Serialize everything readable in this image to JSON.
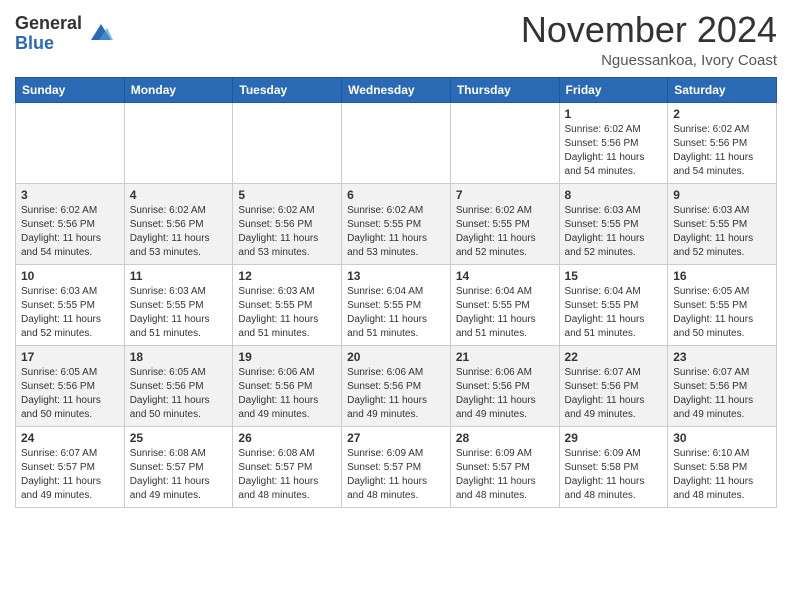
{
  "header": {
    "logo_general": "General",
    "logo_blue": "Blue",
    "month_title": "November 2024",
    "location": "Nguessankoa, Ivory Coast"
  },
  "days_of_week": [
    "Sunday",
    "Monday",
    "Tuesday",
    "Wednesday",
    "Thursday",
    "Friday",
    "Saturday"
  ],
  "weeks": [
    [
      {
        "day": "",
        "info": ""
      },
      {
        "day": "",
        "info": ""
      },
      {
        "day": "",
        "info": ""
      },
      {
        "day": "",
        "info": ""
      },
      {
        "day": "",
        "info": ""
      },
      {
        "day": "1",
        "info": "Sunrise: 6:02 AM\nSunset: 5:56 PM\nDaylight: 11 hours and 54 minutes."
      },
      {
        "day": "2",
        "info": "Sunrise: 6:02 AM\nSunset: 5:56 PM\nDaylight: 11 hours and 54 minutes."
      }
    ],
    [
      {
        "day": "3",
        "info": "Sunrise: 6:02 AM\nSunset: 5:56 PM\nDaylight: 11 hours and 54 minutes."
      },
      {
        "day": "4",
        "info": "Sunrise: 6:02 AM\nSunset: 5:56 PM\nDaylight: 11 hours and 53 minutes."
      },
      {
        "day": "5",
        "info": "Sunrise: 6:02 AM\nSunset: 5:56 PM\nDaylight: 11 hours and 53 minutes."
      },
      {
        "day": "6",
        "info": "Sunrise: 6:02 AM\nSunset: 5:55 PM\nDaylight: 11 hours and 53 minutes."
      },
      {
        "day": "7",
        "info": "Sunrise: 6:02 AM\nSunset: 5:55 PM\nDaylight: 11 hours and 52 minutes."
      },
      {
        "day": "8",
        "info": "Sunrise: 6:03 AM\nSunset: 5:55 PM\nDaylight: 11 hours and 52 minutes."
      },
      {
        "day": "9",
        "info": "Sunrise: 6:03 AM\nSunset: 5:55 PM\nDaylight: 11 hours and 52 minutes."
      }
    ],
    [
      {
        "day": "10",
        "info": "Sunrise: 6:03 AM\nSunset: 5:55 PM\nDaylight: 11 hours and 52 minutes."
      },
      {
        "day": "11",
        "info": "Sunrise: 6:03 AM\nSunset: 5:55 PM\nDaylight: 11 hours and 51 minutes."
      },
      {
        "day": "12",
        "info": "Sunrise: 6:03 AM\nSunset: 5:55 PM\nDaylight: 11 hours and 51 minutes."
      },
      {
        "day": "13",
        "info": "Sunrise: 6:04 AM\nSunset: 5:55 PM\nDaylight: 11 hours and 51 minutes."
      },
      {
        "day": "14",
        "info": "Sunrise: 6:04 AM\nSunset: 5:55 PM\nDaylight: 11 hours and 51 minutes."
      },
      {
        "day": "15",
        "info": "Sunrise: 6:04 AM\nSunset: 5:55 PM\nDaylight: 11 hours and 51 minutes."
      },
      {
        "day": "16",
        "info": "Sunrise: 6:05 AM\nSunset: 5:55 PM\nDaylight: 11 hours and 50 minutes."
      }
    ],
    [
      {
        "day": "17",
        "info": "Sunrise: 6:05 AM\nSunset: 5:56 PM\nDaylight: 11 hours and 50 minutes."
      },
      {
        "day": "18",
        "info": "Sunrise: 6:05 AM\nSunset: 5:56 PM\nDaylight: 11 hours and 50 minutes."
      },
      {
        "day": "19",
        "info": "Sunrise: 6:06 AM\nSunset: 5:56 PM\nDaylight: 11 hours and 49 minutes."
      },
      {
        "day": "20",
        "info": "Sunrise: 6:06 AM\nSunset: 5:56 PM\nDaylight: 11 hours and 49 minutes."
      },
      {
        "day": "21",
        "info": "Sunrise: 6:06 AM\nSunset: 5:56 PM\nDaylight: 11 hours and 49 minutes."
      },
      {
        "day": "22",
        "info": "Sunrise: 6:07 AM\nSunset: 5:56 PM\nDaylight: 11 hours and 49 minutes."
      },
      {
        "day": "23",
        "info": "Sunrise: 6:07 AM\nSunset: 5:56 PM\nDaylight: 11 hours and 49 minutes."
      }
    ],
    [
      {
        "day": "24",
        "info": "Sunrise: 6:07 AM\nSunset: 5:57 PM\nDaylight: 11 hours and 49 minutes."
      },
      {
        "day": "25",
        "info": "Sunrise: 6:08 AM\nSunset: 5:57 PM\nDaylight: 11 hours and 49 minutes."
      },
      {
        "day": "26",
        "info": "Sunrise: 6:08 AM\nSunset: 5:57 PM\nDaylight: 11 hours and 48 minutes."
      },
      {
        "day": "27",
        "info": "Sunrise: 6:09 AM\nSunset: 5:57 PM\nDaylight: 11 hours and 48 minutes."
      },
      {
        "day": "28",
        "info": "Sunrise: 6:09 AM\nSunset: 5:57 PM\nDaylight: 11 hours and 48 minutes."
      },
      {
        "day": "29",
        "info": "Sunrise: 6:09 AM\nSunset: 5:58 PM\nDaylight: 11 hours and 48 minutes."
      },
      {
        "day": "30",
        "info": "Sunrise: 6:10 AM\nSunset: 5:58 PM\nDaylight: 11 hours and 48 minutes."
      }
    ]
  ]
}
